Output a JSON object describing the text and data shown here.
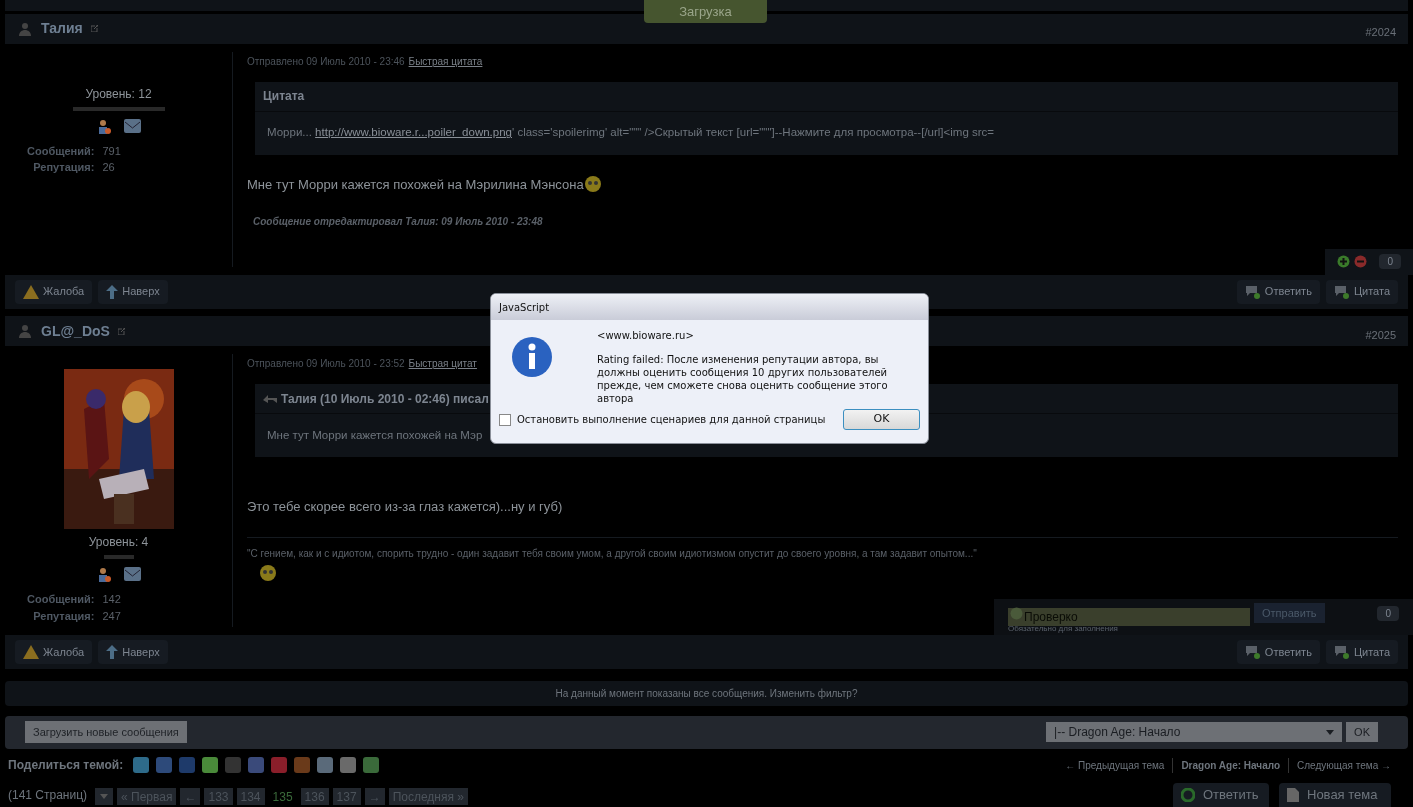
{
  "loading_badge": "Загрузка",
  "posts": [
    {
      "author": "Талия",
      "number": "#2024",
      "avatar": false,
      "level": "Уровень: 12",
      "stats": [
        {
          "label": "Сообщений:",
          "value": "791"
        },
        {
          "label": "Репутация:",
          "value": "26"
        }
      ],
      "meta": "Отправлено 09 Июль 2010 - 23:46",
      "quick_quote": "Быстрая цитата",
      "quote": {
        "kind": "plain",
        "title": "Цитата",
        "before": "Морри... ",
        "link": "http://www.bioware.r...poiler_down.png",
        "after": "' class='spoilerimg' alt=\"\"\" />Скрытый текст [url=\"\"\"]--Нажмите для просмотра--[/url]<img src="
      },
      "body": "Мне тут Морри кажется похожей на Мэрилина Мэнсона",
      "body_smiley": true,
      "edit_note": "Сообщение отредактировал Талия: 09 Июль 2010 - 23:48",
      "rating": {
        "kind": "vote",
        "count": "0"
      },
      "actions_left": [
        "Жалоба",
        "Наверх"
      ],
      "actions_right": [
        "Ответить",
        "Цитата"
      ]
    },
    {
      "author": "GL@_DoS",
      "number": "#2025",
      "avatar": true,
      "level": "Уровень: 4",
      "stats": [
        {
          "label": "Сообщений:",
          "value": "142"
        },
        {
          "label": "Репутация:",
          "value": "247"
        }
      ],
      "meta": "Отправлено 09 Июль 2010 - 23:52",
      "quick_quote": "Быстрая цитат",
      "quote": {
        "kind": "reply",
        "title": "Талия (10 Июль 2010 - 02:46) писал",
        "before": "Мне тут Морри кажется похожей на Мэр"
      },
      "body": "Это тебе скорее всего из-за глаз кажется)...ну и губ)",
      "body_smiley": false,
      "signature": "\"С гением, как и с идиотом, спорить трудно - один задавит тебя своим умом, а другой своим идиотизмом опустит до своего уровня, а там задавит опытом...\"",
      "rating": {
        "kind": "form",
        "value": "Проверко",
        "submit": "Отправить",
        "hint": "Обязательно для заполнения",
        "count": "0"
      },
      "actions_left": [
        "Жалоба",
        "Наверх"
      ],
      "actions_right": [
        "Ответить",
        "Цитата"
      ]
    }
  ],
  "filter_notice": "На данный момент показаны все сообщения. Изменить фильтр?",
  "load_new": "Загрузить новые сообщения",
  "forum_select": {
    "value": "|-- Dragon Age: Начало",
    "go": "OK"
  },
  "share_label": "Поделиться темой:",
  "topic_nav": [
    "← Предыдущая тема",
    "Dragon Age: Начало",
    "Следующая тема →"
  ],
  "pages_label": "(141 Страниц)",
  "pagination": [
    {
      "label": "« Первая",
      "selected": false
    },
    {
      "label": "←",
      "selected": false
    },
    {
      "label": "133",
      "selected": false
    },
    {
      "label": "134",
      "selected": false
    },
    {
      "label": "135",
      "selected": true
    },
    {
      "label": "136",
      "selected": false
    },
    {
      "label": "137",
      "selected": false
    },
    {
      "label": "→",
      "selected": false
    },
    {
      "label": "Последняя »",
      "selected": false
    }
  ],
  "bottom_buttons": [
    "Ответить",
    "Новая тема"
  ],
  "dialog": {
    "title": "JavaScript",
    "site": "<www.bioware.ru>",
    "message": "Rating failed: После изменения репутации автора, вы должны оценить сообщения 10 других пользователей прежде, чем сможете снова оценить сообщение этого автора",
    "checkbox": {
      "label": "Остановить выполнение сценариев для данной страницы",
      "checked": false
    },
    "ok": "OK"
  }
}
